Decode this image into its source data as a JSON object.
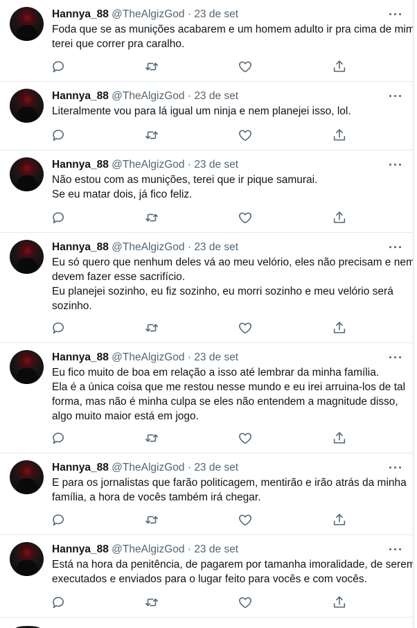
{
  "tweets": [
    {
      "author": "Hannya_88",
      "handle": "@TheAlgizGod",
      "sep": "·",
      "date": "23 de set",
      "lines": [
        "Foda que se as munições acabarem e um homem adulto ir pra cima de mim,",
        "terei que correr pra caralho."
      ]
    },
    {
      "author": "Hannya_88",
      "handle": "@TheAlgizGod",
      "sep": "·",
      "date": "23 de set",
      "lines": [
        "Literalmente vou para lá igual um ninja e nem planejei isso, lol."
      ]
    },
    {
      "author": "Hannya_88",
      "handle": "@TheAlgizGod",
      "sep": "·",
      "date": "23 de set",
      "lines": [
        "Não estou com as munições, terei que ir pique samurai.",
        "Se eu matar dois, já fico feliz."
      ]
    },
    {
      "author": "Hannya_88",
      "handle": "@TheAlgizGod",
      "sep": "·",
      "date": "23 de set",
      "lines": [
        "Eu só quero que nenhum deles vá ao meu velório, eles não precisam e nem",
        "devem fazer esse sacrifício.",
        "Eu planejei sozinho, eu fiz sozinho, eu morri sozinho e meu velório será",
        "sozinho."
      ]
    },
    {
      "author": "Hannya_88",
      "handle": "@TheAlgizGod",
      "sep": "·",
      "date": "23 de set",
      "lines": [
        "Eu fico muito de boa em relação a isso até lembrar da minha família.",
        "Ela é a única coisa que me restou nesse mundo e eu irei arruina-los de tal",
        "forma, mas não é minha culpa se eles não entendem a magnitude disso,",
        "algo muito maior está em jogo."
      ]
    },
    {
      "author": "Hannya_88",
      "handle": "@TheAlgizGod",
      "sep": "·",
      "date": "23 de set",
      "lines": [
        "E para os jornalistas que farão politicagem, mentirão e irão atrás da minha",
        "família, a hora de vocês também irá chegar."
      ]
    },
    {
      "author": "Hannya_88",
      "handle": "@TheAlgizGod",
      "sep": "·",
      "date": "23 de set",
      "lines": [
        "Está na hora da penitência, de pagarem por tamanha imoralidade, de serem",
        "executados e enviados para o lugar feito para vocês e com vocês."
      ]
    }
  ],
  "icons": {
    "reply": "reply-icon",
    "retweet": "retweet-icon",
    "like": "heart-icon",
    "share": "share-icon",
    "more": "more-icon"
  },
  "colors": {
    "text": "#0f1419",
    "secondary": "#536471",
    "divider": "#e6e9eb"
  }
}
